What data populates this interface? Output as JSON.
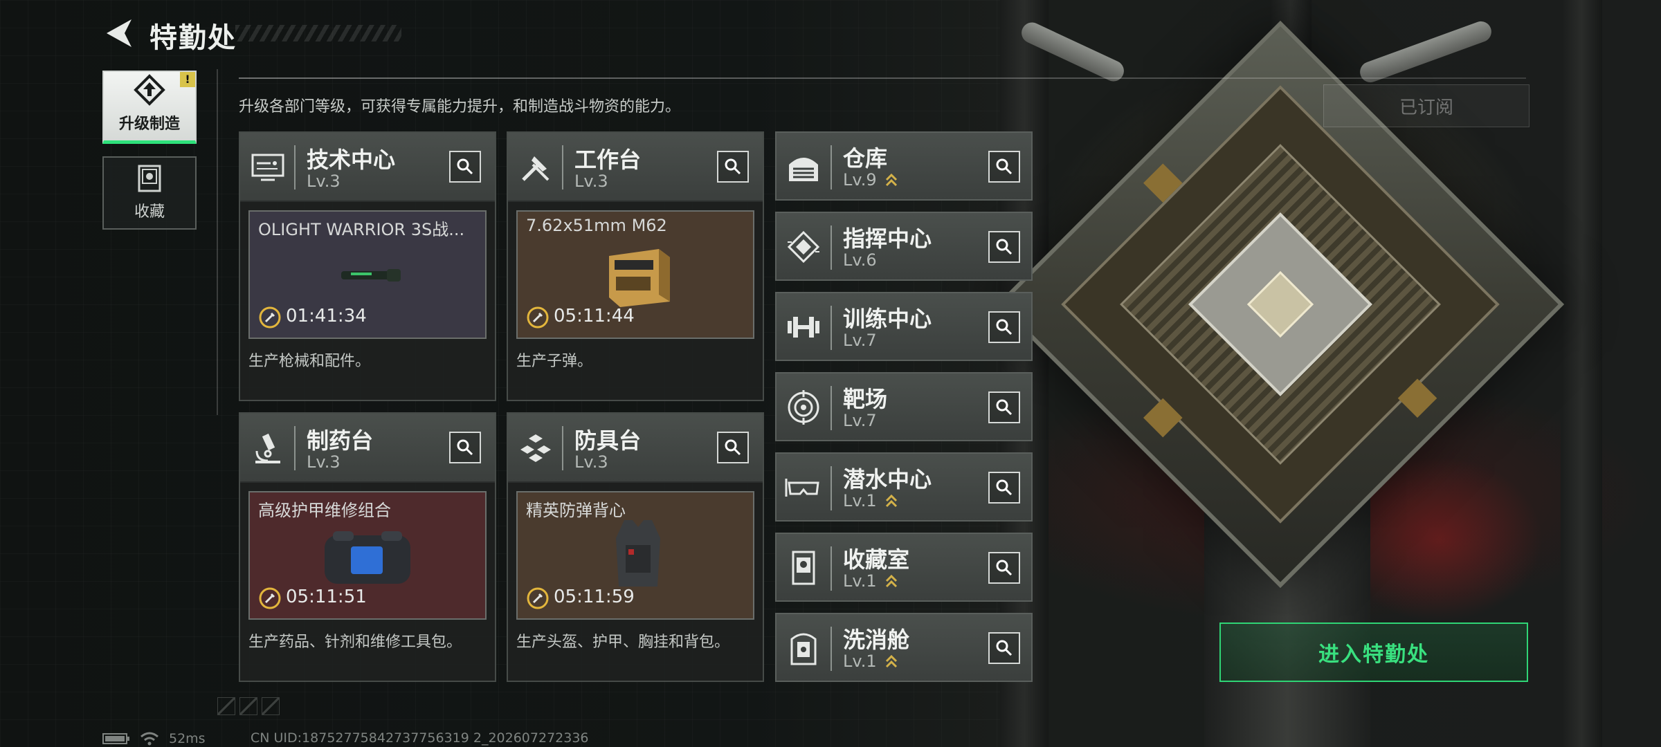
{
  "header": {
    "title": "特勤处",
    "description": "升级各部门等级，可获得专属能力提升，和制造战斗物资的能力。",
    "subscribe_label": "已订阅"
  },
  "nav": {
    "items": [
      {
        "label": "升级制造",
        "icon": "upgrade-icon",
        "active": true,
        "alert": "!"
      },
      {
        "label": "收藏",
        "icon": "collection-icon",
        "active": false
      }
    ]
  },
  "production_cards": [
    {
      "name": "技术中心",
      "level": "Lv.3",
      "icon": "monitor-icon",
      "item": "OLIGHT WARRIOR 3S战...",
      "timer": "01:41:34",
      "desc": "生产枪械和配件。",
      "bg": "#3a3844"
    },
    {
      "name": "工作台",
      "level": "Lv.3",
      "icon": "tools-icon",
      "item": "7.62x51mm M62",
      "timer": "05:11:44",
      "desc": "生产子弹。",
      "bg": "#4a3b2e"
    },
    {
      "name": "制药台",
      "level": "Lv.3",
      "icon": "microscope-icon",
      "item": "高级护甲维修组合",
      "timer": "05:11:51",
      "desc": "生产药品、针剂和维修工具包。",
      "bg": "#4e2a2c"
    },
    {
      "name": "防具台",
      "level": "Lv.3",
      "icon": "armor-blocks-icon",
      "item": "精英防弹背心",
      "timer": "05:11:59",
      "desc": "生产头盔、护甲、胸挂和背包。",
      "bg": "#4a3b2e"
    }
  ],
  "side_departments": [
    {
      "name": "仓库",
      "level": "Lv.9",
      "icon": "warehouse-icon",
      "upgradable": true
    },
    {
      "name": "指挥中心",
      "level": "Lv.6",
      "icon": "command-chip-icon",
      "upgradable": false
    },
    {
      "name": "训练中心",
      "level": "Lv.7",
      "icon": "dumbbell-icon",
      "upgradable": false
    },
    {
      "name": "靶场",
      "level": "Lv.7",
      "icon": "target-icon",
      "upgradable": false
    },
    {
      "name": "潜水中心",
      "level": "Lv.1",
      "icon": "diving-mask-icon",
      "upgradable": true
    },
    {
      "name": "收藏室",
      "level": "Lv.1",
      "icon": "display-case-icon",
      "upgradable": true
    },
    {
      "name": "洗消舱",
      "level": "Lv.1",
      "icon": "decontamination-icon",
      "upgradable": true
    }
  ],
  "enter_button": "进入特勤处",
  "status": {
    "ping": "52ms",
    "uid": "CN UID:18752775842737756319 2_202607272336"
  },
  "colors": {
    "accent": "#2fd575",
    "upgrade_arrow": "#d4b24a",
    "alert": "#d8c34a"
  }
}
